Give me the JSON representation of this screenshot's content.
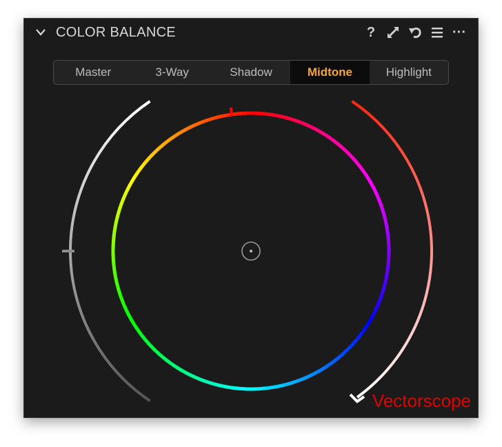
{
  "panel": {
    "title": "COLOR BALANCE",
    "icons": [
      "chevron-down-icon",
      "help-icon",
      "expand-icon",
      "reset-icon",
      "menu-icon",
      "more-icon"
    ],
    "help_glyph": "?",
    "more_glyph": "···"
  },
  "tabs": {
    "items": [
      "Master",
      "3-Way",
      "Shadow",
      "Midtone",
      "Highlight"
    ],
    "active": "Midtone"
  },
  "scope": {
    "label": "Vectorscope",
    "colors": {
      "accent": "#f5a63a",
      "label": "#e00000",
      "panel_bg": "#1b1b1b"
    },
    "hue_marker_degrees": 8,
    "lightness_marker_value": 0.5
  }
}
